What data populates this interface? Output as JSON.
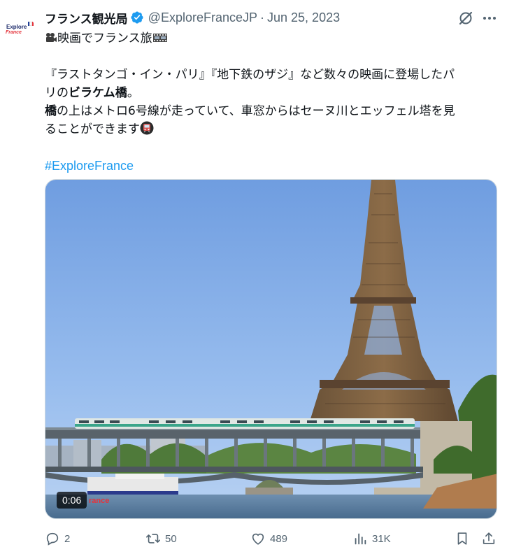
{
  "author": {
    "avatar_line1": "Explore",
    "avatar_line2": "France",
    "display_name": "フランス観光局",
    "handle": "@ExploreFranceJP",
    "separator": "·",
    "date": "Jun 25, 2023",
    "flag_colors": [
      "#1f3f98",
      "#ffffff",
      "#e4343c"
    ]
  },
  "text": {
    "line1": "映画でフランス旅",
    "line2": "『ラストタンゴ・イン・パリ』『地下鉄のザジ』など数々の映画に登場したパ",
    "line3_pre": "リの",
    "line3_bold": "ビラケム橋",
    "line3_post": "。",
    "line4_bold": "橋",
    "line4_rest": "の上はメトロ6号線が走っていて、車窓からはセーヌ川とエッフェル塔を見",
    "line5": "ることができます",
    "hashtag": "#ExploreFrance"
  },
  "media": {
    "duration": "0:06",
    "overlay_text": "rance"
  },
  "actions": {
    "replies": "2",
    "reposts": "50",
    "likes": "489",
    "views": "31K"
  },
  "icons": [
    "verified-badge-icon",
    "grok-icon",
    "more-icon",
    "movie-camera-icon",
    "film-frames-icon",
    "metro-train-icon",
    "reply-icon",
    "repost-icon",
    "like-icon",
    "views-icon",
    "bookmark-icon",
    "share-icon"
  ],
  "colors": {
    "accent": "#1d9bf0",
    "secondary_text": "#536471",
    "primary_text": "#0f1419"
  }
}
